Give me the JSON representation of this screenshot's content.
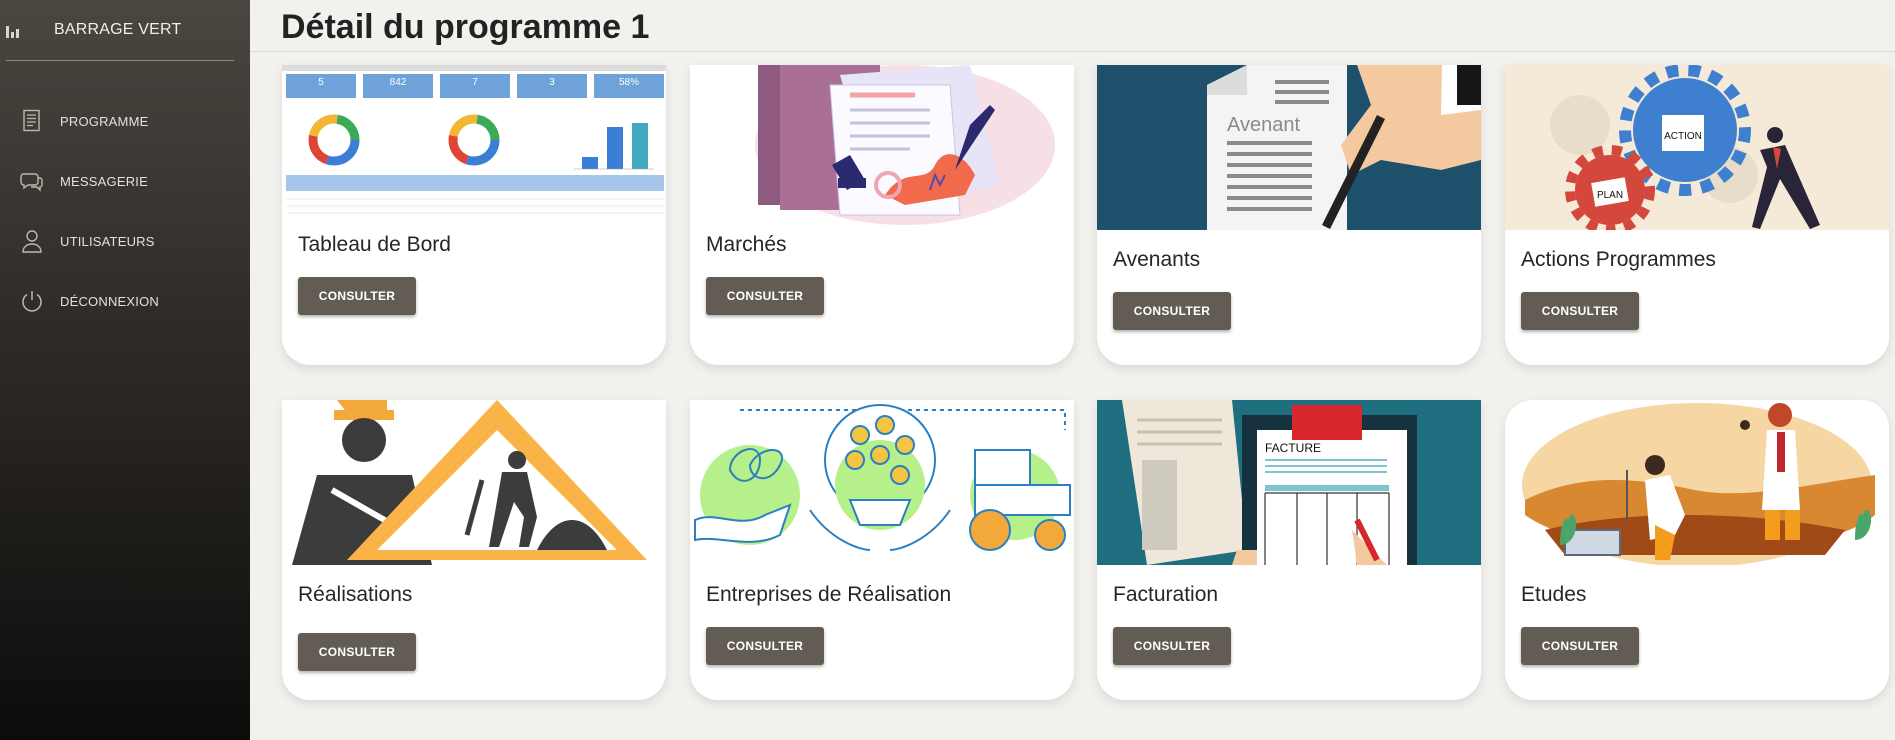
{
  "sidebar": {
    "brand": "BARRAGE VERT",
    "items": [
      {
        "label": "PROGRAMME",
        "icon": "document-icon"
      },
      {
        "label": "MESSAGERIE",
        "icon": "chat-icon"
      },
      {
        "label": "UTILISATEURS",
        "icon": "user-icon"
      },
      {
        "label": "DÉCONNEXION",
        "icon": "power-icon"
      }
    ]
  },
  "page": {
    "title": "Détail du programme 1"
  },
  "dashboard_thumb": {
    "kpis": [
      "5",
      "842",
      "7",
      "3",
      "58%"
    ]
  },
  "cards": [
    {
      "title": "Tableau de Bord",
      "button": "CONSULTER"
    },
    {
      "title": "Marchés",
      "button": "CONSULTER"
    },
    {
      "title": "Avenants",
      "button": "CONSULTER",
      "image_text": "Avenant"
    },
    {
      "title": "Actions Programmes",
      "button": "CONSULTER",
      "image_text_1": "ACTION",
      "image_text_2": "PLAN"
    },
    {
      "title": "Réalisations",
      "button": "CONSULTER"
    },
    {
      "title": "Entreprises de Réalisation",
      "button": "CONSULTER"
    },
    {
      "title": "Facturation",
      "button": "CONSULTER",
      "image_text": "FACTURE"
    },
    {
      "title": "Etudes",
      "button": "CONSULTER"
    }
  ]
}
